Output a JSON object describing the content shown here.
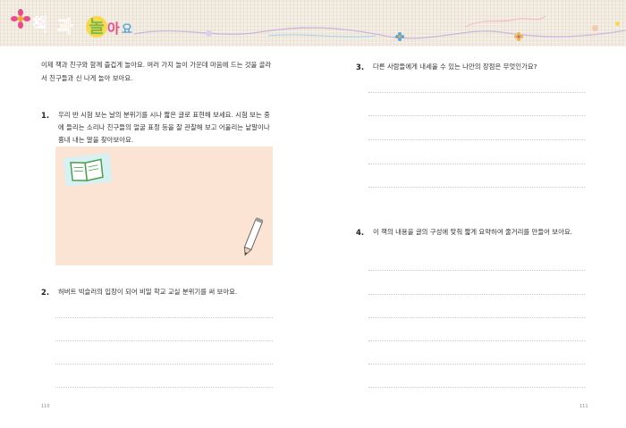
{
  "banner": {
    "logo_chars": [
      "책",
      "과",
      "놀",
      "아",
      "요"
    ],
    "colors": {
      "c1": "#e84c8b",
      "c2": "#f4a623",
      "c3": "#7fb94a",
      "c4": "#e84c8b",
      "c5": "#5aa8d8"
    }
  },
  "left": {
    "intro": "이제 책과 친구와 함께 즐겁게 놀아요. 여러 가지 놀이 가운데 마음에 드는 것을 골라서 친구들과 신 나게 놀아 보아요.",
    "q1": {
      "number": "1.",
      "text": "우리 반 시험 보는 날의 분위기를 시나 짧은 글로 표현해 보세요. 시험 보는 중에 들리는 소리나 친구들의 얼굴 표정 등을 잘 관찰해 보고 어울리는 낱말이나 흉내 내는 말을 찾아보아요."
    },
    "q2": {
      "number": "2.",
      "text": "허버트 빅슬러의 입장이 되어 비밀 학교 교실 분위기를 써 보아요."
    },
    "page_number": "110"
  },
  "right": {
    "q3": {
      "number": "3.",
      "text": "다른 사람들에게 내세울 수 있는 나만의 장점은 무엇인가요?"
    },
    "q4": {
      "number": "4.",
      "text": "이 책의 내용을 글의 구성에 맞춰 짧게 요약하여 줄거리를 만들어 보아요."
    },
    "page_number": "111"
  }
}
